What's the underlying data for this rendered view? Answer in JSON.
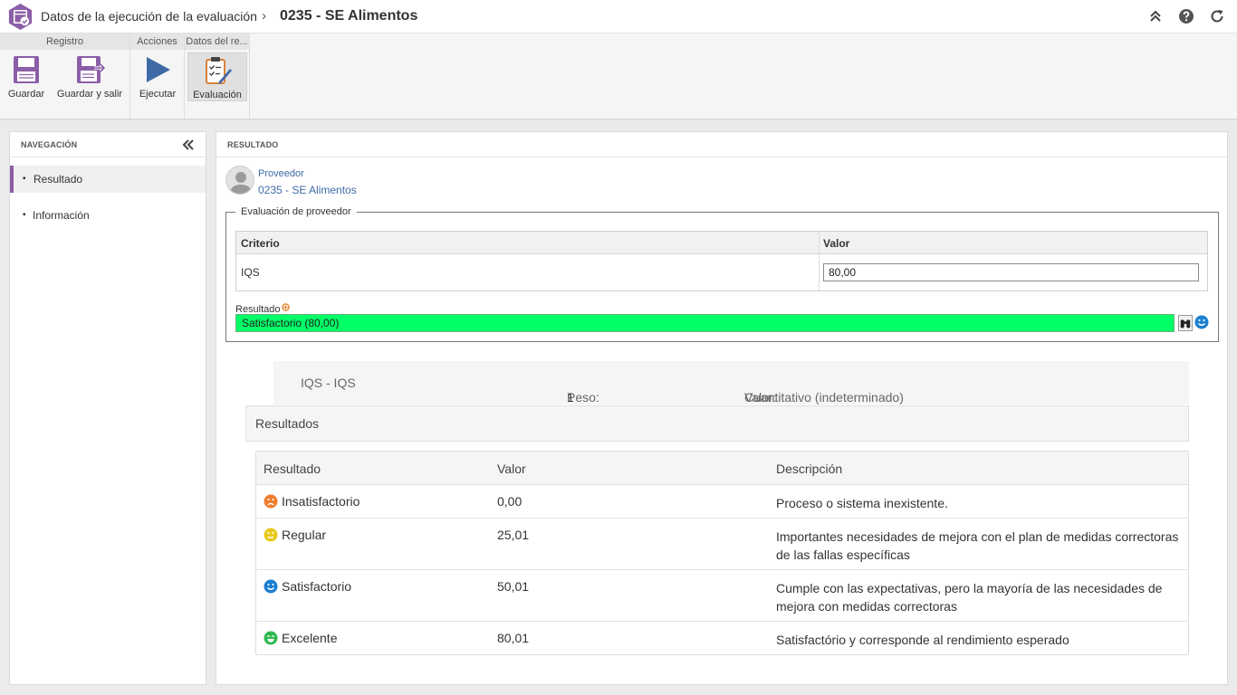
{
  "header": {
    "title": "Datos de la ejecución de la evaluación",
    "separator": "›",
    "record": "0235 - SE Alimentos"
  },
  "ribbon": {
    "groups": [
      {
        "title": "Registro",
        "buttons": [
          {
            "label": "Guardar",
            "icon": "save-icon"
          },
          {
            "label": "Guardar y salir",
            "icon": "save-exit-icon"
          }
        ]
      },
      {
        "title": "Acciones",
        "buttons": [
          {
            "label": "Ejecutar",
            "icon": "play-icon"
          }
        ]
      },
      {
        "title": "Datos del re...",
        "buttons": [
          {
            "label": "Evaluación",
            "icon": "evaluation-clipboard-icon"
          }
        ]
      }
    ]
  },
  "navigation": {
    "title": "NAVEGACIÓN",
    "items": [
      {
        "label": "Resultado",
        "active": true
      },
      {
        "label": "Información",
        "active": false
      }
    ]
  },
  "main": {
    "title": "RESULTADO",
    "supplier": {
      "label": "Proveedor",
      "value": "0235 - SE Alimentos"
    },
    "evaluation": {
      "legend": "Evaluación de proveedor",
      "columns": [
        "Criterio",
        "Valor"
      ],
      "rows": [
        {
          "criterion": "IQS",
          "value": "80,00"
        }
      ]
    },
    "result": {
      "label": "Resultado",
      "value": "Satisfactorio (80,00)",
      "bar_color": "#00ff66"
    },
    "criterion_info": {
      "name": "IQS - IQS",
      "weight_label": "Peso:",
      "weight": "1",
      "value_type_label": "Valor:",
      "value_type": "Cuantitativo (indeterminado)"
    },
    "results_section": {
      "title": "Resultados",
      "columns": [
        "Resultado",
        "Valor",
        "Descripción"
      ],
      "rows": [
        {
          "icon": "sad-face-icon",
          "color": "#f07c2e",
          "result": "Insatisfactorio",
          "value": "0,00",
          "description": "Proceso o sistema inexistente."
        },
        {
          "icon": "neutral-face-icon",
          "color": "#e8c91a",
          "result": "Regular",
          "value": "25,01",
          "description": "Importantes necesidades de mejora con el plan de medidas correctoras de las fallas específicas"
        },
        {
          "icon": "smile-face-icon",
          "color": "#1b7fd1",
          "result": "Satisfactorio",
          "value": "50,01",
          "description": "Cumple con las expectativas, pero la mayoría de las necesidades de mejora con medidas correctoras"
        },
        {
          "icon": "grin-face-icon",
          "color": "#2eb84f",
          "result": "Excelente",
          "value": "80,01",
          "description": "Satisfactório y corresponde al rendimiento esperado"
        }
      ]
    }
  },
  "colors": {
    "accent": "#8b5ea7",
    "link": "#3f6aa6"
  }
}
